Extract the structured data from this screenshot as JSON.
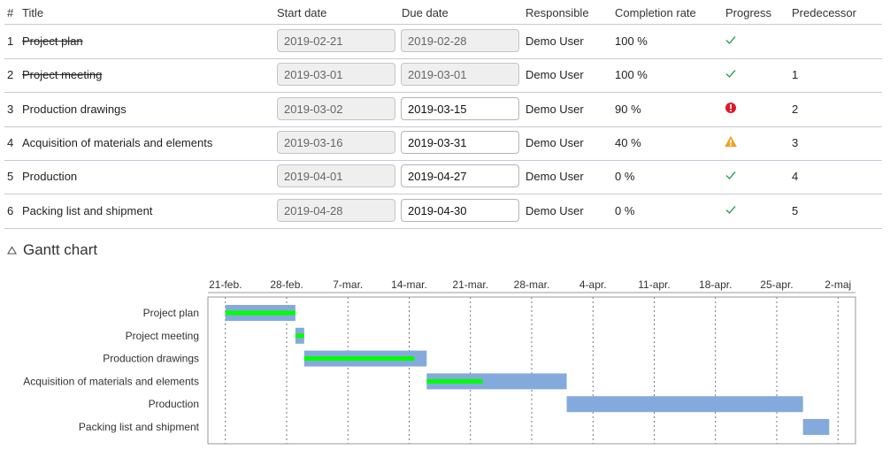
{
  "table": {
    "columns": {
      "num": "#",
      "title": "Title",
      "start": "Start date",
      "due": "Due date",
      "responsible": "Responsible",
      "completion": "Completion rate",
      "progress": "Progress",
      "predecessor": "Predecessor"
    },
    "rows": [
      {
        "num": "1",
        "title": "Project plan",
        "start": "2019-02-21",
        "due": "2019-02-28",
        "due_editable": false,
        "responsible": "Demo User",
        "completion": "100 %",
        "progress": "check-icon",
        "predecessor": "",
        "done": true
      },
      {
        "num": "2",
        "title": "Project meeting",
        "start": "2019-03-01",
        "due": "2019-03-01",
        "due_editable": false,
        "responsible": "Demo User",
        "completion": "100 %",
        "progress": "check-icon",
        "predecessor": "1",
        "done": true
      },
      {
        "num": "3",
        "title": "Production drawings",
        "start": "2019-03-02",
        "due": "2019-03-15",
        "due_editable": true,
        "responsible": "Demo User",
        "completion": "90 %",
        "progress": "error-icon",
        "predecessor": "2",
        "done": false
      },
      {
        "num": "4",
        "title": "Acquisition of materials and elements",
        "start": "2019-03-16",
        "due": "2019-03-31",
        "due_editable": true,
        "responsible": "Demo User",
        "completion": "40 %",
        "progress": "warning-icon",
        "predecessor": "3",
        "done": false
      },
      {
        "num": "5",
        "title": "Production",
        "start": "2019-04-01",
        "due": "2019-04-27",
        "due_editable": true,
        "responsible": "Demo User",
        "completion": "0 %",
        "progress": "check-icon",
        "predecessor": "4",
        "done": false
      },
      {
        "num": "6",
        "title": "Packing list and shipment",
        "start": "2019-04-28",
        "due": "2019-04-30",
        "due_editable": true,
        "responsible": "Demo User",
        "completion": "0 %",
        "progress": "check-icon",
        "predecessor": "5",
        "done": false
      }
    ]
  },
  "gantt_section": {
    "title": "Gantt chart",
    "toggle_icon": "collapse-triangle-icon"
  },
  "colors": {
    "bar": "#84aadd",
    "progress": "#00ff00",
    "check": "#2e9e5b",
    "error": "#e0182a",
    "warning": "#f0a020"
  },
  "chart_data": {
    "type": "gantt",
    "tick_labels": [
      "21-feb.",
      "28-feb.",
      "7-mar.",
      "14-mar.",
      "21-mar.",
      "28-mar.",
      "4-apr.",
      "11-apr.",
      "18-apr.",
      "25-apr.",
      "2-maj"
    ],
    "tick_dates": [
      "2019-02-21",
      "2019-02-28",
      "2019-03-07",
      "2019-03-14",
      "2019-03-21",
      "2019-03-28",
      "2019-04-04",
      "2019-04-11",
      "2019-04-18",
      "2019-04-25",
      "2019-05-02"
    ],
    "x_range": [
      "2019-02-19",
      "2019-05-04"
    ],
    "tasks": [
      {
        "label": "Project plan",
        "start": "2019-02-21",
        "end": "2019-02-28",
        "progress": 1.0
      },
      {
        "label": "Project meeting",
        "start": "2019-03-01",
        "end": "2019-03-01",
        "progress": 1.0
      },
      {
        "label": "Production drawings",
        "start": "2019-03-02",
        "end": "2019-03-15",
        "progress": 0.9
      },
      {
        "label": "Acquisition of materials and elements",
        "start": "2019-03-16",
        "end": "2019-03-31",
        "progress": 0.4
      },
      {
        "label": "Production",
        "start": "2019-04-01",
        "end": "2019-04-27",
        "progress": 0.0
      },
      {
        "label": "Packing list and shipment",
        "start": "2019-04-28",
        "end": "2019-04-30",
        "progress": 0.0
      }
    ],
    "grid": true
  }
}
